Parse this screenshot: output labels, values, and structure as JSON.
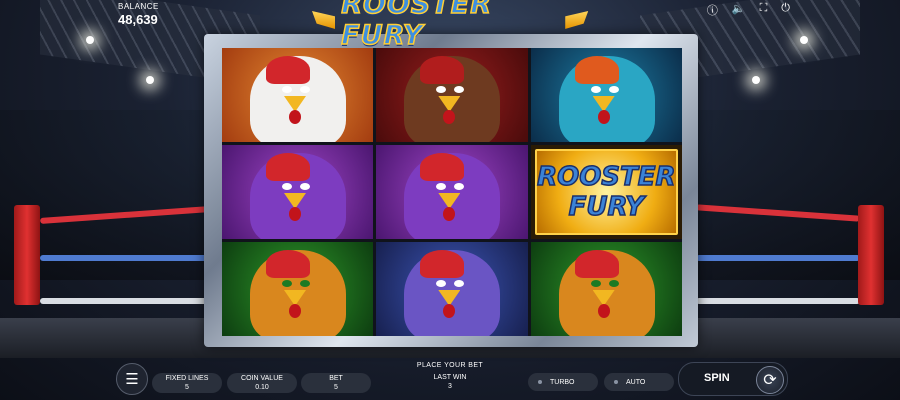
{
  "game": {
    "title": "ROOSTER FURY"
  },
  "header": {
    "balance_label": "BALANCE",
    "balance_value": "48,639",
    "icons": [
      "info-icon",
      "sound-icon",
      "fullscreen-icon",
      "power-icon"
    ]
  },
  "reels": {
    "rows": [
      [
        "orange-rooster",
        "red-bandana-rooster",
        "blue-helmet-rooster"
      ],
      [
        "purple-rooster",
        "purple-rooster",
        "wild-rooster-fury"
      ],
      [
        "green-mask-rooster",
        "blue-purple-rooster",
        "green-mask-rooster"
      ]
    ],
    "wild_text": [
      "ROOSTER",
      "FURY"
    ]
  },
  "controls": {
    "status": "PLACE YOUR BET",
    "fixed_lines_label": "FIXED LINES",
    "fixed_lines_value": "5",
    "coin_value_label": "COIN VALUE",
    "coin_value_value": "0.10",
    "bet_label": "BET",
    "bet_value": "5",
    "last_win_label": "LAST WIN",
    "last_win_value": "3",
    "turbo_label": "TURBO",
    "auto_label": "AUTO",
    "spin_label": "SPIN"
  },
  "colors": {
    "accent": "#f0ad13",
    "logo_blue": "#3d8fe0",
    "ring_red": "#e03131",
    "bar": "#2a303c"
  }
}
